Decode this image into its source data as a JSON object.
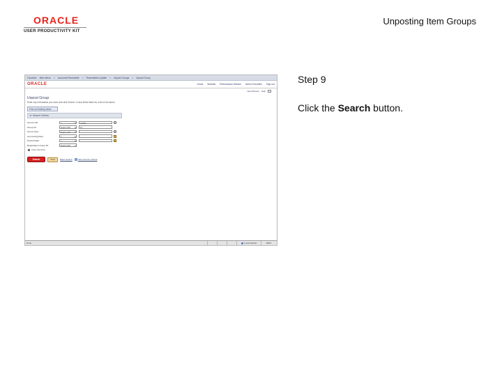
{
  "header": {
    "logo_word": "ORACLE",
    "logo_sub": "USER PRODUCTIVITY KIT",
    "title": "Unposting Item Groups"
  },
  "step": {
    "label": "Step 9",
    "instruction_pre": "Click the ",
    "instruction_bold": "Search",
    "instruction_post": " button."
  },
  "screenshot": {
    "nav_items": [
      "Favorites",
      "Main Menu",
      ">",
      "Accounts Receivable",
      ">",
      "Receivables Update",
      ">",
      "Unpost Groups",
      ">",
      "Unpost Group"
    ],
    "brand": "ORACLE",
    "header_links": [
      "Home",
      "Worklist",
      "Performance Monitor",
      "Add to Favorites",
      "Sign out"
    ],
    "util_links": [
      "New Window",
      "Help"
    ],
    "content_title": "Unpost Group",
    "content_instructions": "Enter any information you have and click Search. Leave fields blank for a list of all values.",
    "tab_label": "Find an Existing Value",
    "criteria_label": "Search Criteria",
    "fields": [
      {
        "label": "Group Unit:",
        "op": "=",
        "value": "US001",
        "icon": "lookup"
      },
      {
        "label": "Group ID:",
        "op": "begins with",
        "value": "12",
        "icon": ""
      },
      {
        "label": "Group Type:",
        "op": "begins with",
        "value": "",
        "icon": "lookup"
      },
      {
        "label": "Accounting Date:",
        "op": "=",
        "value": "",
        "icon": "calendar"
      },
      {
        "label": "Posted Date:",
        "op": "=",
        "value": "",
        "icon": "calendar"
      },
      {
        "label": "Registration Group ID:",
        "op": "begins with",
        "value": "",
        "icon": ""
      }
    ],
    "case_sensitive": "Case Sensitive",
    "search_button": "Search",
    "clear_button": "Clear",
    "basic_search": "Basic Search",
    "save_criteria": "Save Search Criteria",
    "status_done": "Done",
    "status_zone1": "Local intranet",
    "status_zone2": "100%"
  },
  "colors": {
    "oracle_red": "#e8221b",
    "search_button": "#d71f1f"
  }
}
